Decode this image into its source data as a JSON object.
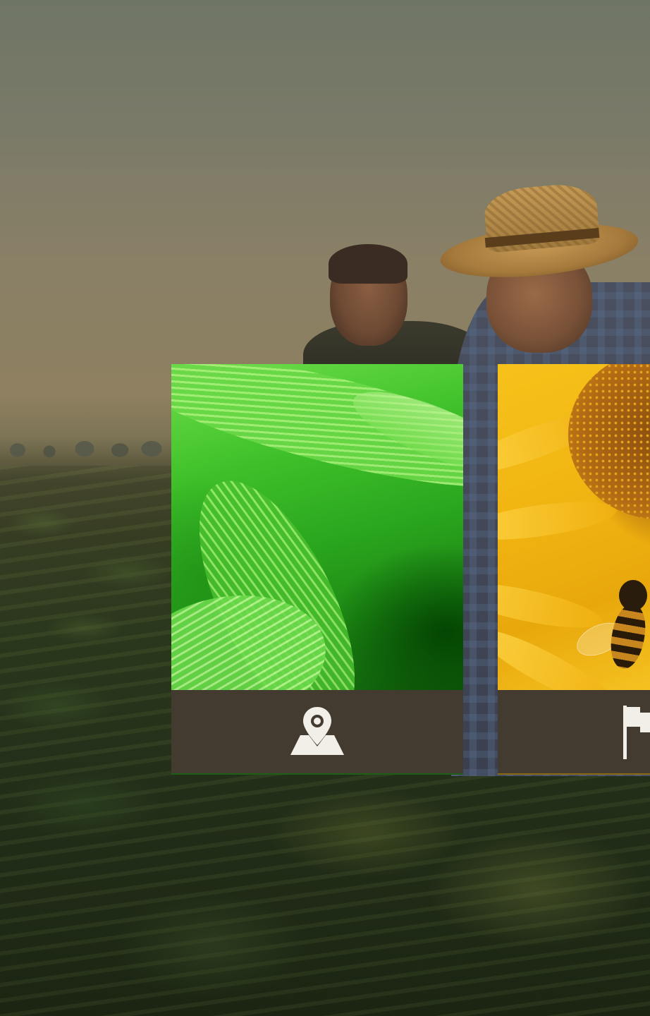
{
  "colors": {
    "card_footer": "#433b30",
    "icon": "#ffffff"
  },
  "cards": [
    {
      "image": "corn-leaves-photo",
      "icon": "map-pin-icon"
    },
    {
      "image": "sunflower-bee-photo",
      "icon": "flag-icon"
    }
  ]
}
